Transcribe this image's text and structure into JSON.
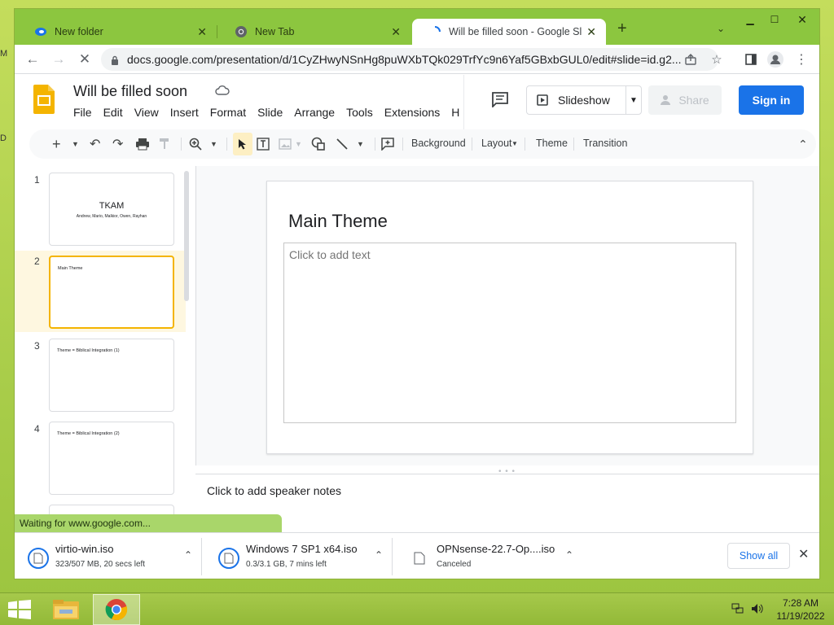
{
  "browser": {
    "tabs": [
      {
        "title": "New folder",
        "icon": "folder-app-icon"
      },
      {
        "title": "New Tab",
        "icon": "chrome-icon"
      },
      {
        "title": "Will be filled soon - Google Slides",
        "icon": "loading-spinner-icon",
        "active": true
      }
    ],
    "url": "docs.google.com/presentation/d/1CyZHwyNSnHg8puWXbTQk029TrfYc9n6Yaf5GBxbGUL0/edit#slide=id.g2..."
  },
  "slides_app": {
    "doc_title": "Will be filled soon",
    "menu": [
      "File",
      "Edit",
      "View",
      "Insert",
      "Format",
      "Slide",
      "Arrange",
      "Tools",
      "Extensions",
      "H"
    ],
    "slideshow_label": "Slideshow",
    "share_label": "Share",
    "signin_label": "Sign in",
    "toolbar_text": {
      "background": "Background",
      "layout": "Layout",
      "theme": "Theme",
      "transition": "Transition"
    },
    "filmstrip": [
      {
        "num": "1",
        "title": "TKAM",
        "subtitle": "Andrew, Mario, Malkior, Owen, Rayhan"
      },
      {
        "num": "2",
        "title": "Main Theme",
        "selected": true
      },
      {
        "num": "3",
        "title": "Theme = Biblical Integration (1)"
      },
      {
        "num": "4",
        "title": "Theme = Biblical Integration (2)"
      }
    ],
    "current_slide": {
      "title": "Main Theme",
      "body_placeholder": "Click to add text"
    },
    "speaker_notes_placeholder": "Click to add speaker notes"
  },
  "status_text": "Waiting for www.google.com...",
  "downloads": {
    "items": [
      {
        "name": "virtio-win.iso",
        "status": "323/507 MB, 20 secs left"
      },
      {
        "name": "Windows 7 SP1 x64.iso",
        "status": "0.3/3.1 GB, 7 mins left"
      },
      {
        "name": "OPNsense-22.7-Op....iso",
        "status": "Canceled"
      }
    ],
    "show_all": "Show all"
  },
  "taskbar": {
    "time": "7:28 AM",
    "date": "11/19/2022"
  },
  "colors": {
    "accent_blue": "#1a73e8",
    "slides_yellow": "#f4b400",
    "chrome_frame": "#8cc63f"
  }
}
